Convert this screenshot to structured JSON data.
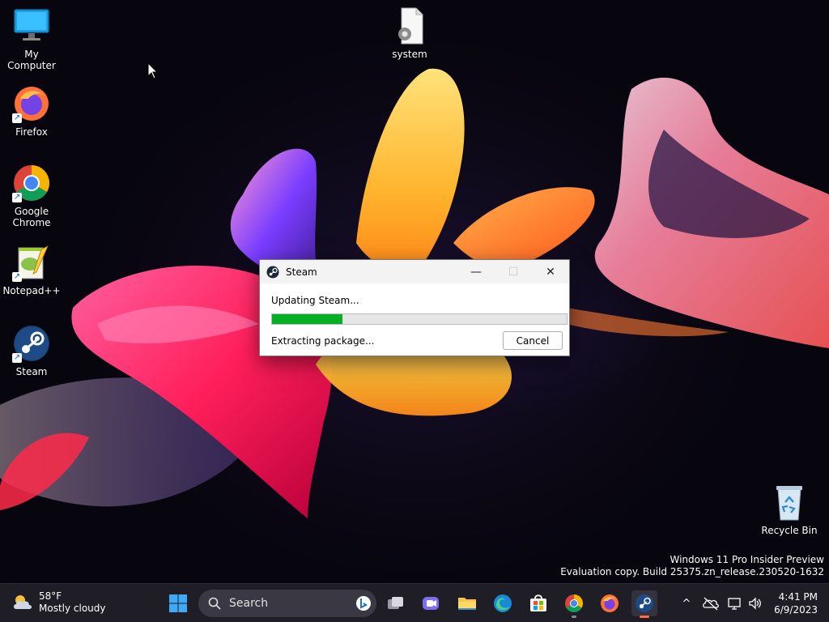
{
  "desktop": {
    "icons": [
      {
        "label": "My Computer"
      },
      {
        "label": "Firefox"
      },
      {
        "label": "Google Chrome"
      },
      {
        "label": "Notepad++"
      },
      {
        "label": "Steam"
      },
      {
        "label": "system"
      },
      {
        "label": "Recycle Bin"
      }
    ]
  },
  "dialog": {
    "title": "Steam",
    "heading": "Updating Steam...",
    "progress_fraction": 0.24,
    "status": "Extracting package...",
    "cancel_label": "Cancel",
    "minimize_glyph": "—",
    "maximize_glyph": "☐",
    "close_glyph": "✕"
  },
  "watermark": {
    "line1": "Windows 11 Pro Insider Preview",
    "line2": "Evaluation copy. Build 25375.zn_release.230520-1632"
  },
  "taskbar": {
    "weather_temp": "58°F",
    "weather_desc": "Mostly cloudy",
    "search_placeholder": "Search",
    "pinned": [
      "start-icon",
      "task-view-icon",
      "teams-icon",
      "file-explorer-icon",
      "edge-icon",
      "store-icon",
      "chrome-icon",
      "firefox-icon",
      "steam-icon"
    ],
    "tray_chevron": "^",
    "time": "4:41 PM",
    "date": "6/9/2023"
  },
  "colors": {
    "progress": "#06b025",
    "accent_running": "#ff6a4c"
  }
}
